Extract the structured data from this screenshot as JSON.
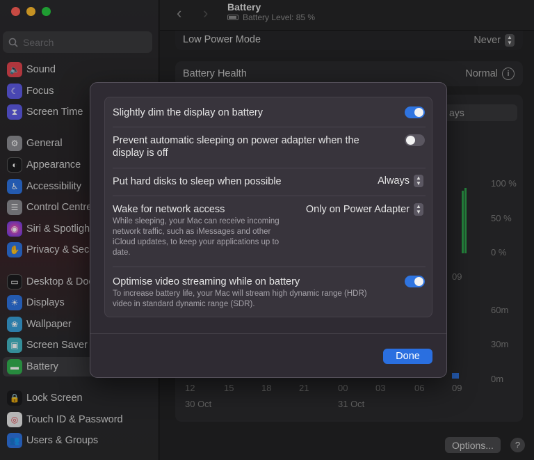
{
  "sidebar": {
    "search_placeholder": "Search",
    "items": [
      {
        "label": "Sound",
        "icon": "speaker-icon",
        "color": "#e0464f"
      },
      {
        "label": "Focus",
        "icon": "moon-icon",
        "color": "#5e5ce6"
      },
      {
        "label": "Screen Time",
        "icon": "hourglass-icon",
        "color": "#5e5ce6"
      },
      {
        "label": "General",
        "icon": "gear-icon",
        "color": "#8e8e93"
      },
      {
        "label": "Appearance",
        "icon": "appearance-icon",
        "color": "#1c1c1e"
      },
      {
        "label": "Accessibility",
        "icon": "accessibility-icon",
        "color": "#2f74e0"
      },
      {
        "label": "Control Centre",
        "icon": "control-centre-icon",
        "color": "#8e8e93"
      },
      {
        "label": "Siri & Spotlight",
        "icon": "siri-icon",
        "color": "#b548c6"
      },
      {
        "label": "Privacy & Security",
        "icon": "hand-icon",
        "color": "#2f74e0"
      },
      {
        "label": "Desktop & Dock",
        "icon": "dock-icon",
        "color": "#1c1c1e"
      },
      {
        "label": "Displays",
        "icon": "sun-icon",
        "color": "#2f74e0"
      },
      {
        "label": "Wallpaper",
        "icon": "wallpaper-icon",
        "color": "#39a0d9"
      },
      {
        "label": "Screen Saver",
        "icon": "screen-saver-icon",
        "color": "#45b7c4"
      },
      {
        "label": "Battery",
        "icon": "battery-icon",
        "color": "#33b150"
      },
      {
        "label": "Lock Screen",
        "icon": "lock-icon",
        "color": "#1c1c1e"
      },
      {
        "label": "Touch ID & Password",
        "icon": "fingerprint-icon",
        "color": "#e8e8e8"
      },
      {
        "label": "Users & Groups",
        "icon": "users-icon",
        "color": "#2f74e0"
      }
    ],
    "selected": "Battery"
  },
  "header": {
    "title": "Battery",
    "subtitle": "Battery Level: 85 %"
  },
  "main": {
    "low_power_label": "Low Power Mode",
    "low_power_value": "Never",
    "health_label": "Battery Health",
    "health_value": "Normal",
    "partial_text": "ays",
    "chart_y_labels_level": [
      "100 %",
      "50 %",
      "0 %"
    ],
    "chart_x_partial_top": "09",
    "chart_y_labels_usage": [
      "60m",
      "30m",
      "0m"
    ],
    "chart_x_ticks": [
      "12",
      "15",
      "18",
      "21",
      "00",
      "03",
      "06",
      "09"
    ],
    "chart_dates": [
      "30 Oct",
      "31 Oct"
    ],
    "options_label": "Options...",
    "help_label": "?"
  },
  "modal": {
    "rows": [
      {
        "title": "Slightly dim the display on battery",
        "control": "toggle",
        "on": true
      },
      {
        "title": "Prevent automatic sleeping on power adapter when the display is off",
        "control": "toggle",
        "on": false
      },
      {
        "title": "Put hard disks to sleep when possible",
        "control": "select",
        "value": "Always"
      },
      {
        "title": "Wake for network access",
        "control": "select",
        "value": "Only on Power Adapter",
        "desc": "While sleeping, your Mac can receive incoming network traffic, such as iMessages and other iCloud updates, to keep your applications up to date."
      },
      {
        "title": "Optimise video streaming while on battery",
        "control": "toggle",
        "on": true,
        "desc": "To increase battery life, your Mac will stream high dynamic range (HDR) video in standard dynamic range (SDR)."
      }
    ],
    "done_label": "Done"
  },
  "colors": {
    "accent": "#2f74e0",
    "toggle_off": "#5a5660",
    "chart_green": "#2fa84d"
  }
}
